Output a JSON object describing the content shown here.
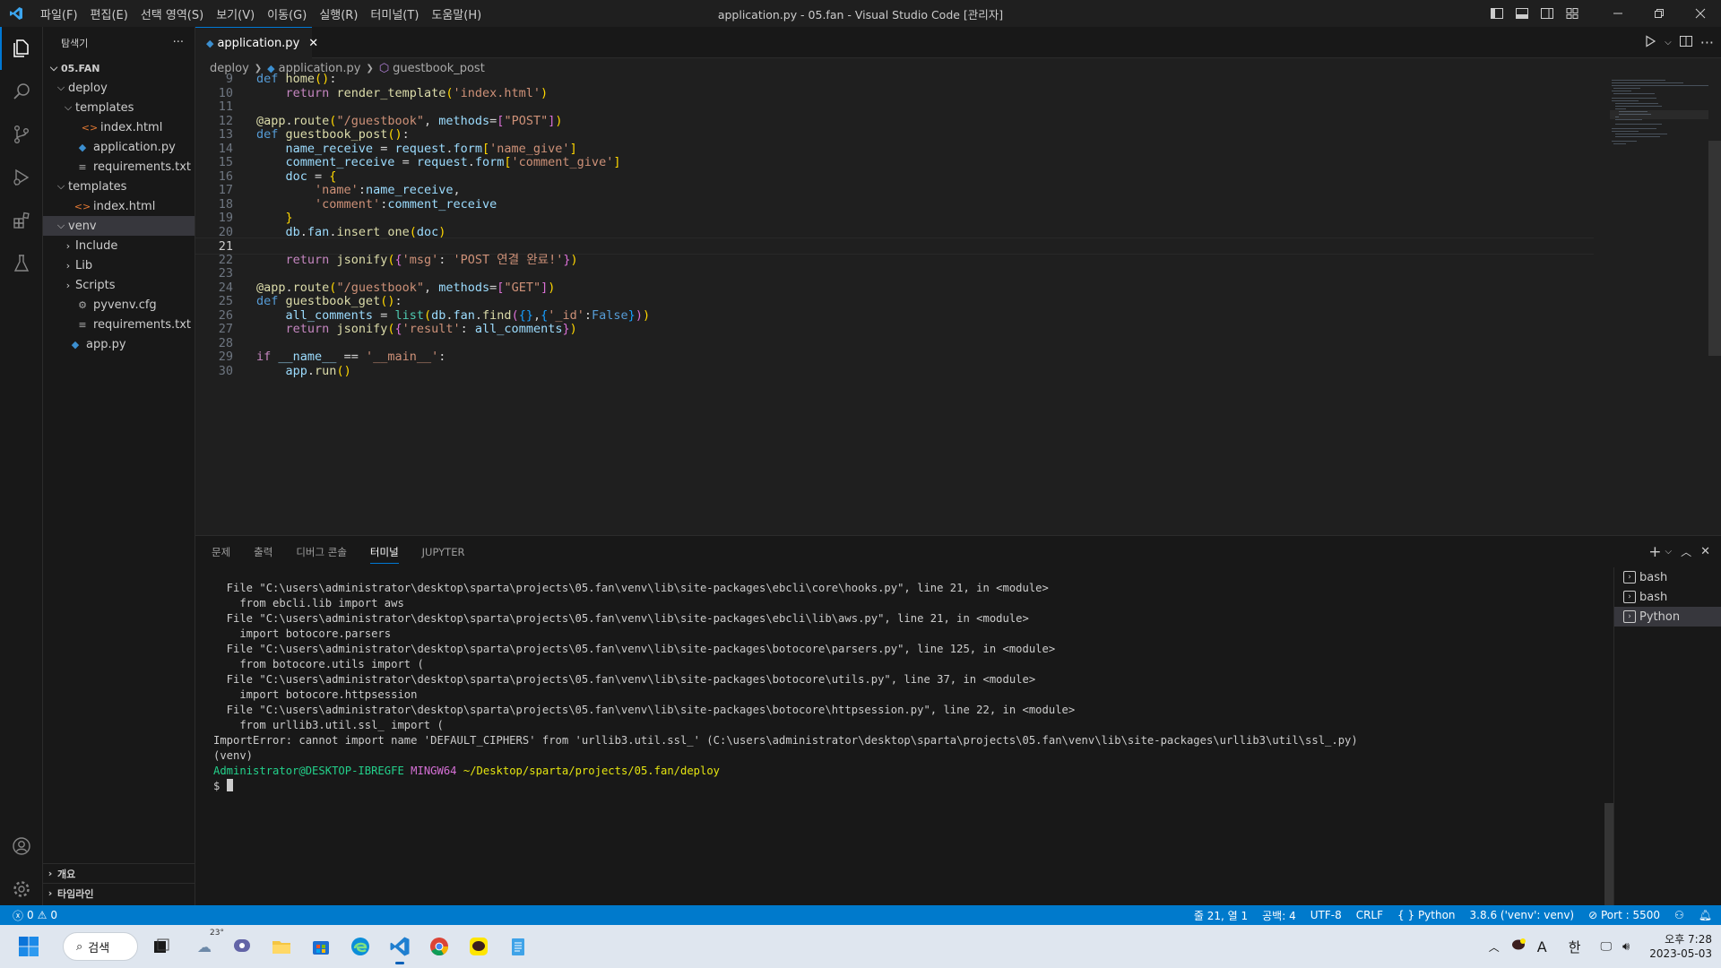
{
  "titlebar": {
    "menu": [
      "파일(F)",
      "편집(E)",
      "선택 영역(S)",
      "보기(V)",
      "이동(G)",
      "실행(R)",
      "터미널(T)",
      "도움말(H)"
    ],
    "title": "application.py - 05.fan - Visual Studio Code [관리자]"
  },
  "sidebar": {
    "header": "탐색기",
    "more": "···",
    "root": "05.FAN",
    "tree": [
      {
        "label": "deploy",
        "kind": "folder-open",
        "depth": 1
      },
      {
        "label": "templates",
        "kind": "folder-open",
        "depth": 2
      },
      {
        "label": "index.html",
        "kind": "html",
        "depth": 3
      },
      {
        "label": "application.py",
        "kind": "py",
        "depth": 2
      },
      {
        "label": "requirements.txt",
        "kind": "txt",
        "depth": 2
      },
      {
        "label": "templates",
        "kind": "folder-open",
        "depth": 1
      },
      {
        "label": "index.html",
        "kind": "html",
        "depth": 2
      },
      {
        "label": "venv",
        "kind": "folder-open",
        "depth": 1,
        "selected": true
      },
      {
        "label": "Include",
        "kind": "folder",
        "depth": 2
      },
      {
        "label": "Lib",
        "kind": "folder",
        "depth": 2
      },
      {
        "label": "Scripts",
        "kind": "folder",
        "depth": 2
      },
      {
        "label": "pyvenv.cfg",
        "kind": "cfg",
        "depth": 2
      },
      {
        "label": "requirements.txt",
        "kind": "txt",
        "depth": 2
      },
      {
        "label": "app.py",
        "kind": "py",
        "depth": 1
      }
    ],
    "outline": "개요",
    "timeline": "타임라인"
  },
  "tab": {
    "label": "application.py"
  },
  "breadcrumb": {
    "folder": "deploy",
    "file": "application.py",
    "symbol": "guestbook_post"
  },
  "editor": {
    "current_line": 21,
    "lines": [
      9,
      10,
      11,
      12,
      13,
      14,
      15,
      16,
      17,
      18,
      19,
      20,
      21,
      22,
      23,
      24,
      25,
      26,
      27,
      28,
      29,
      30
    ]
  },
  "panel": {
    "tabs": [
      "문제",
      "출력",
      "디버그 콘솔",
      "터미널",
      "JUPYTER"
    ],
    "active_tab": "터미널",
    "terminal_lines": [
      "  File \"C:\\users\\administrator\\desktop\\sparta\\projects\\05.fan\\venv\\lib\\site-packages\\ebcli\\core\\hooks.py\", line 21, in <module>",
      "    from ebcli.lib import aws",
      "  File \"C:\\users\\administrator\\desktop\\sparta\\projects\\05.fan\\venv\\lib\\site-packages\\ebcli\\lib\\aws.py\", line 21, in <module>",
      "    import botocore.parsers",
      "  File \"C:\\users\\administrator\\desktop\\sparta\\projects\\05.fan\\venv\\lib\\site-packages\\botocore\\parsers.py\", line 125, in <module>",
      "    from botocore.utils import (",
      "  File \"C:\\users\\administrator\\desktop\\sparta\\projects\\05.fan\\venv\\lib\\site-packages\\botocore\\utils.py\", line 37, in <module>",
      "    import botocore.httpsession",
      "  File \"C:\\users\\administrator\\desktop\\sparta\\projects\\05.fan\\venv\\lib\\site-packages\\botocore\\httpsession.py\", line 22, in <module>",
      "    from urllib3.util.ssl_ import (",
      "ImportError: cannot import name 'DEFAULT_CIPHERS' from 'urllib3.util.ssl_' (C:\\users\\administrator\\desktop\\sparta\\projects\\05.fan\\venv\\lib\\site-packages\\urllib3\\util\\ssl_.py)",
      "(venv)"
    ],
    "prompt_user": "Administrator@DESKTOP-IBREGFE",
    "prompt_shell": "MINGW64",
    "prompt_path": "~/Desktop/sparta/projects/05.fan/deploy",
    "prompt_symbol": "$",
    "terminals": [
      "bash",
      "bash",
      "Python"
    ]
  },
  "statusbar": {
    "errors": "0",
    "warnings": "0",
    "position": "줄 21, 열 1",
    "spaces": "공백: 4",
    "encoding": "UTF-8",
    "eol": "CRLF",
    "language": "Python",
    "interpreter": "3.8.6 ('venv': venv)",
    "port": "Port : 5500"
  },
  "taskbar": {
    "search": "검색",
    "weather": "23°",
    "ime": "한",
    "time": "오후 7:28",
    "date": "2023-05-03",
    "font_label": "A"
  },
  "colors": {
    "accent": "#007acc",
    "editor_bg": "#1f1f1f",
    "sidebar_bg": "#181818"
  }
}
